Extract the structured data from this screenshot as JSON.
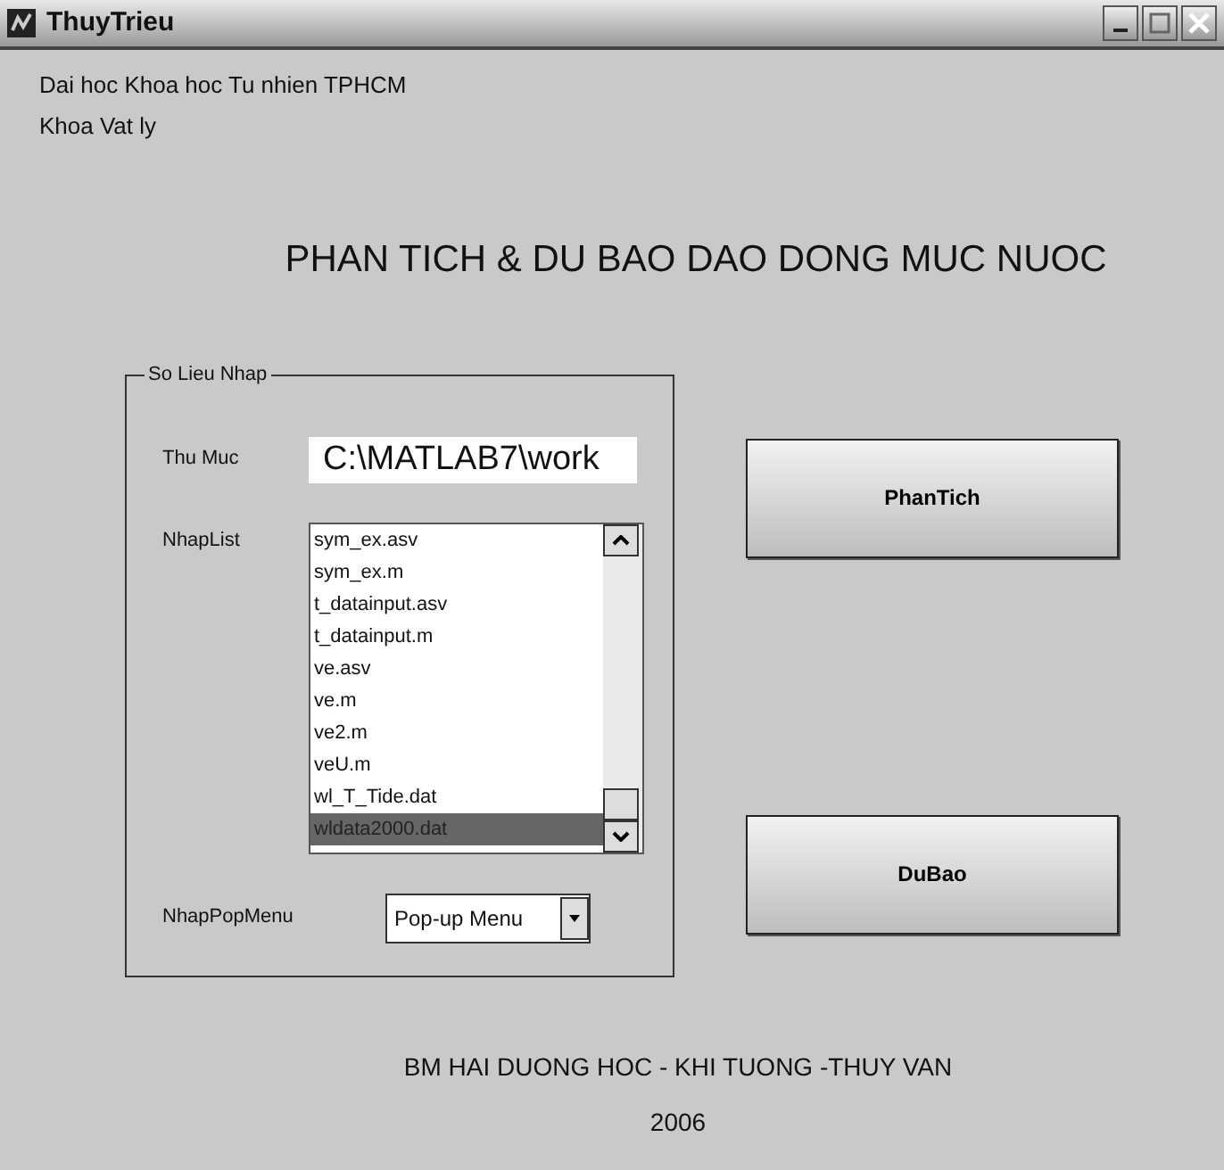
{
  "window": {
    "title": "ThuyTrieu"
  },
  "header_lines": [
    "Dai hoc Khoa hoc Tu nhien TPHCM",
    "Khoa Vat ly"
  ],
  "heading": "PHAN TICH & DU BAO DAO DONG MUC NUOC",
  "group": {
    "title": "So Lieu Nhap",
    "folder": {
      "label": "Thu Muc",
      "value": "C:\\MATLAB7\\work"
    },
    "list": {
      "label": "NhapList",
      "items": [
        {
          "text": "sym_ex.asv",
          "selected": false
        },
        {
          "text": "sym_ex.m",
          "selected": false
        },
        {
          "text": "t_datainput.asv",
          "selected": false
        },
        {
          "text": "t_datainput.m",
          "selected": false
        },
        {
          "text": "ve.asv",
          "selected": false
        },
        {
          "text": "ve.m",
          "selected": false
        },
        {
          "text": "ve2.m",
          "selected": false
        },
        {
          "text": "veU.m",
          "selected": false
        },
        {
          "text": "wl_T_Tide.dat",
          "selected": false
        },
        {
          "text": "wldata2000.dat",
          "selected": true
        }
      ]
    },
    "popup": {
      "label": "NhapPopMenu",
      "value": "Pop-up Menu"
    }
  },
  "buttons": [
    "PhanTich",
    "DuBao"
  ],
  "footer": [
    "BM HAI DUONG HOC - KHI TUONG -THUY VAN",
    "2006"
  ]
}
